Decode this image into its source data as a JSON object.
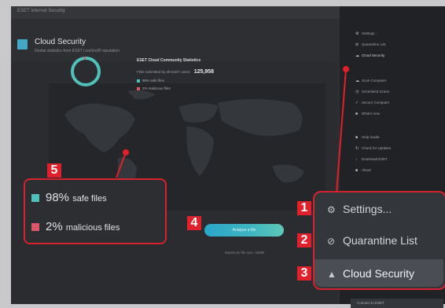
{
  "window": {
    "title": "ESET Internet Security"
  },
  "header": {
    "title": "Cloud Security",
    "subtitle": "Global statistics from ESET LiveGrid® reputation"
  },
  "stats": {
    "title": "ESET Cloud Community Statistics",
    "line_text": "Files submitted by all ESET users:",
    "count": "125,958",
    "safe_label": "98% safe files",
    "malicious_label": "2% malicious files",
    "safe_fraction": 0.98,
    "malicious_fraction": 0.02
  },
  "analyze": {
    "button_label": "Analyze a file",
    "note": "Maximum file size: 32MB"
  },
  "sidebar": {
    "items": [
      {
        "label": "Settings...",
        "icon": "gear-icon"
      },
      {
        "label": "Quarantine List",
        "icon": "quarantine-icon"
      },
      {
        "label": "Cloud Security",
        "icon": "cloud-icon"
      },
      {
        "label": "Scan Computer",
        "icon": "scan-icon"
      },
      {
        "label": "Scheduled Scans",
        "icon": "schedule-icon"
      },
      {
        "label": "Secure Computer",
        "icon": "shield-icon"
      },
      {
        "label": "What's new",
        "icon": "info-icon"
      },
      {
        "label": "Help Guide",
        "icon": "help-icon"
      },
      {
        "label": "Check for Updates",
        "icon": "update-icon"
      },
      {
        "label": "Download ESET",
        "icon": "download-icon"
      },
      {
        "label": "About",
        "icon": "about-icon"
      }
    ],
    "bottom": "Connect to ESET"
  },
  "callouts": {
    "n1": "1",
    "n2": "2",
    "n3": "3",
    "n4": "4",
    "n5": "5",
    "big_safe_pct": "98%",
    "big_safe_rest": "safe files",
    "big_mal_pct": "2%",
    "big_mal_rest": "malicious files",
    "menu_settings": "Settings...",
    "menu_quarantine": "Quarantine List",
    "menu_cloud": "Cloud Security"
  },
  "colors": {
    "accent": "#2aa6c9",
    "safe": "#4fc1b8",
    "malicious": "#d8586a",
    "callout_red": "#e0202b"
  }
}
